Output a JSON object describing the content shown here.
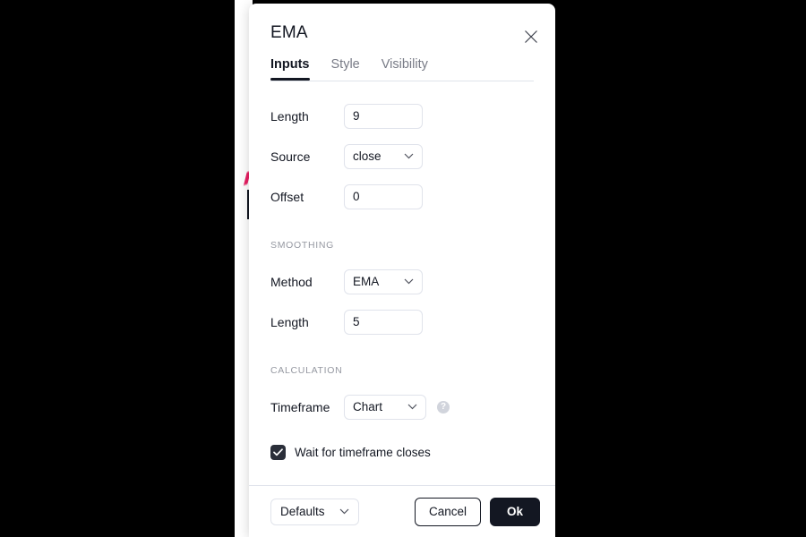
{
  "dialog": {
    "title": "EMA",
    "close_icon": "close-icon",
    "tabs": [
      {
        "label": "Inputs",
        "active": true
      },
      {
        "label": "Style",
        "active": false
      },
      {
        "label": "Visibility",
        "active": false
      }
    ],
    "inputs": {
      "length_label": "Length",
      "length_value": "9",
      "source_label": "Source",
      "source_value": "close",
      "offset_label": "Offset",
      "offset_value": "0"
    },
    "smoothing": {
      "section_label": "SMOOTHING",
      "method_label": "Method",
      "method_value": "EMA",
      "length_label": "Length",
      "length_value": "5"
    },
    "calculation": {
      "section_label": "CALCULATION",
      "timeframe_label": "Timeframe",
      "timeframe_value": "Chart",
      "help_icon": "?",
      "wait_checkbox_label": "Wait for timeframe closes",
      "wait_checkbox_checked": true
    },
    "footer": {
      "defaults_label": "Defaults",
      "cancel_label": "Cancel",
      "ok_label": "Ok"
    }
  },
  "colors": {
    "accent_dark": "#131722",
    "border": "#e0e3eb",
    "muted_text": "#9598a1",
    "chart_ema_line": "#e91e63",
    "backdrop": "#000000"
  }
}
